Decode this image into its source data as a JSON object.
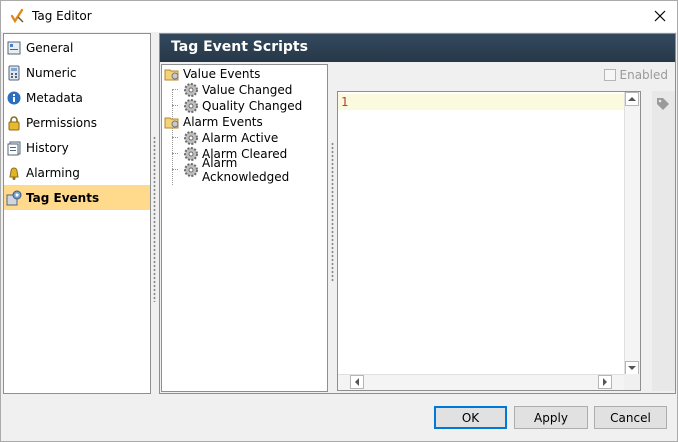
{
  "window": {
    "title": "Tag Editor"
  },
  "nav": {
    "items": [
      {
        "label": "General",
        "icon": "general-icon",
        "selected": false
      },
      {
        "label": "Numeric",
        "icon": "numeric-icon",
        "selected": false
      },
      {
        "label": "Metadata",
        "icon": "metadata-icon",
        "selected": false
      },
      {
        "label": "Permissions",
        "icon": "lock-icon",
        "selected": false
      },
      {
        "label": "History",
        "icon": "history-icon",
        "selected": false
      },
      {
        "label": "Alarming",
        "icon": "bell-icon",
        "selected": false
      },
      {
        "label": "Tag Events",
        "icon": "tag-events-icon",
        "selected": true
      }
    ]
  },
  "panel": {
    "title": "Tag Event Scripts",
    "tree": {
      "groups": [
        {
          "label": "Value Events",
          "children": [
            "Value Changed",
            "Quality Changed"
          ]
        },
        {
          "label": "Alarm Events",
          "children": [
            "Alarm Active",
            "Alarm Cleared",
            "Alarm Acknowledged"
          ]
        }
      ]
    },
    "enabled_label": "Enabled",
    "enabled_checked": false,
    "editor": {
      "line_number": "1"
    }
  },
  "buttons": {
    "ok": "OK",
    "apply": "Apply",
    "cancel": "Cancel"
  },
  "colors": {
    "selected_bg": "#ffd98c",
    "header_bg": "#2d4052",
    "current_line": "#fbfadf"
  }
}
